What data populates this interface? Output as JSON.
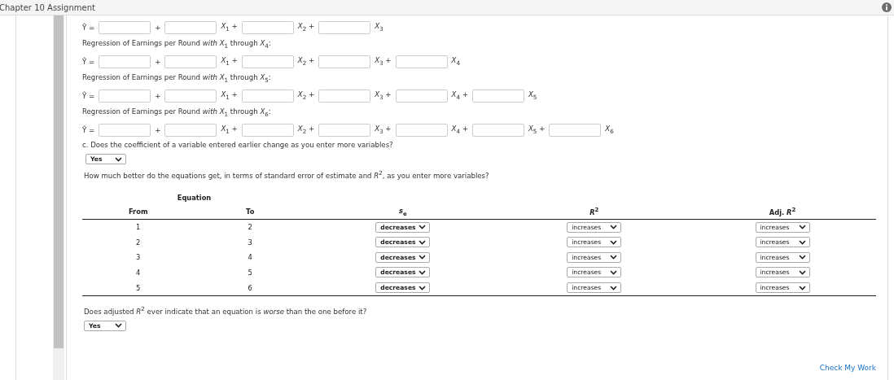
{
  "header": {
    "title": "Chapter 10 Assignment"
  },
  "blocks": [
    {
      "kind": "equation",
      "lead": "Ŷ =",
      "terms": [
        "+",
        "*X*$_{1}$ +",
        "*X*$_{2}$ +",
        "*X*$_{3}$"
      ]
    },
    {
      "kind": "caption",
      "text": "Regression of Earnings per Round *with* *X*$_{1}$ through *X*$_{4}$:"
    },
    {
      "kind": "equation",
      "lead": "Ŷ =",
      "terms": [
        "+",
        "*X*$_{1}$ +",
        "*X*$_{2}$ +",
        "*X*$_{3}$ +",
        "*X*$_{4}$"
      ]
    },
    {
      "kind": "caption",
      "text": "Regression of Earnings per Round *with* *X*$_{1}$ through *X*$_{5}$:"
    },
    {
      "kind": "equation",
      "lead": "Ŷ =",
      "terms": [
        "+",
        "*X*$_{1}$ +",
        "*X*$_{2}$ +",
        "*X*$_{3}$ +",
        "*X*$_{4}$ +",
        "*X*$_{5}$"
      ]
    },
    {
      "kind": "caption",
      "text": "Regression of Earnings per Round *with* *X*$_{1}$ through *X*$_{6}$:"
    },
    {
      "kind": "equation",
      "lead": "Ŷ =",
      "terms": [
        "+",
        "*X*$_{1}$ +",
        "*X*$_{2}$ +",
        "*X*$_{3}$ +",
        "*X*$_{4}$ +",
        "*X*$_{5}$ +",
        "*X*$_{6}$"
      ]
    }
  ],
  "question_c": {
    "text": "c. Does the coefficient of a variable entered earlier change as you enter more variables?",
    "answer": "Yes"
  },
  "question_table": {
    "text": "How much better do the equations get, in terms of standard error of estimate and *R*$^{2}$, as you enter more variables?"
  },
  "table": {
    "group_header": "Equation",
    "columns": [
      "From",
      "To",
      "*s*$_{e}$",
      "*R*$^{2}$",
      "Adj. *R*$^{2}$"
    ],
    "rows": [
      {
        "from": "1",
        "to": "2",
        "se": "decreases",
        "r2": "increases",
        "adj_r2": "increases"
      },
      {
        "from": "2",
        "to": "3",
        "se": "decreases",
        "r2": "increases",
        "adj_r2": "increases"
      },
      {
        "from": "3",
        "to": "4",
        "se": "decreases",
        "r2": "increases",
        "adj_r2": "increases"
      },
      {
        "from": "4",
        "to": "5",
        "se": "decreases",
        "r2": "increases",
        "adj_r2": "increases"
      },
      {
        "from": "5",
        "to": "6",
        "se": "decreases",
        "r2": "increases",
        "adj_r2": "increases"
      }
    ]
  },
  "question_adjusted": {
    "text": "Does adjusted *R*$^{2}$ ever indicate that an equation is *worse* than the one before it?",
    "answer": "Yes"
  },
  "footer": {
    "link": "Check My Work"
  }
}
